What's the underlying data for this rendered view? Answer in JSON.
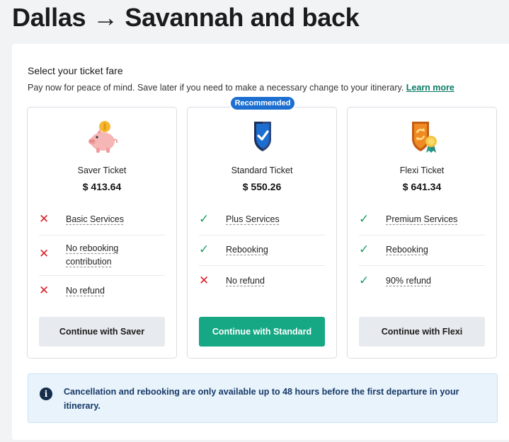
{
  "page": {
    "title": "Dallas → Savannah and back"
  },
  "fare_section": {
    "heading": "Select your ticket fare",
    "subtext": "Pay now for peace of mind. Save later if you need to make a necessary change to your itinerary. ",
    "learn_more": "Learn more"
  },
  "cards": [
    {
      "icon": "piggy-bank-icon",
      "name": "Saver Ticket",
      "price": "$ 413.64",
      "features": [
        {
          "status": "excluded",
          "text": "Basic Services"
        },
        {
          "status": "excluded",
          "text": "No rebooking contribution"
        },
        {
          "status": "excluded",
          "text": "No refund"
        }
      ],
      "button": "Continue with Saver"
    },
    {
      "badge": "Recommended",
      "icon": "shield-check-icon",
      "name": "Standard Ticket",
      "price": "$ 550.26",
      "features": [
        {
          "status": "included",
          "text": "Plus Services"
        },
        {
          "status": "included",
          "text": "Rebooking"
        },
        {
          "status": "excluded",
          "text": "No refund"
        }
      ],
      "button": "Continue with Standard"
    },
    {
      "icon": "flexi-badge-icon",
      "name": "Flexi Ticket",
      "price": "$ 641.34",
      "features": [
        {
          "status": "included",
          "text": "Premium Services"
        },
        {
          "status": "included",
          "text": "Rebooking"
        },
        {
          "status": "included",
          "text": "90% refund"
        }
      ],
      "button": "Continue with Flexi"
    }
  ],
  "info_notice": {
    "icon": "info-icon",
    "text": "Cancellation and rebooking are only available up to 48 hours before the first departure in your itinerary."
  },
  "colors": {
    "accent_green": "#16a784",
    "badge_blue": "#1c6fd1",
    "cross_red": "#d8232a",
    "check_green": "#1f9e61",
    "info_bg": "#e8f3fc"
  }
}
